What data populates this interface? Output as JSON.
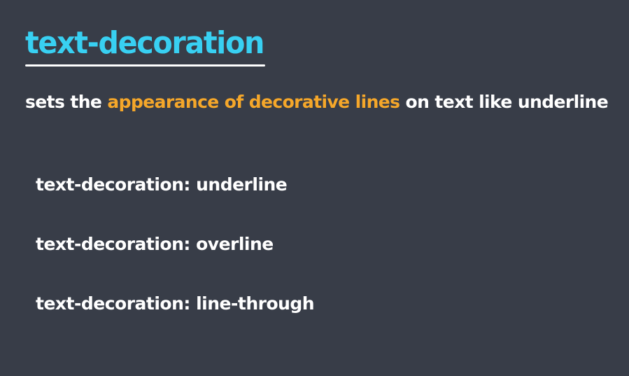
{
  "slide": {
    "title": "text-decoration",
    "subtitle": {
      "before": "sets the ",
      "highlight": "appearance of decorative lines",
      "after": " on text like underline"
    },
    "examples": [
      "text-decoration: underline",
      "text-decoration: overline",
      "text-decoration: line-through"
    ],
    "colors": {
      "background": "#383d48",
      "title": "#38d0f2",
      "highlight": "#f5a72a",
      "text": "#ffffff"
    }
  }
}
